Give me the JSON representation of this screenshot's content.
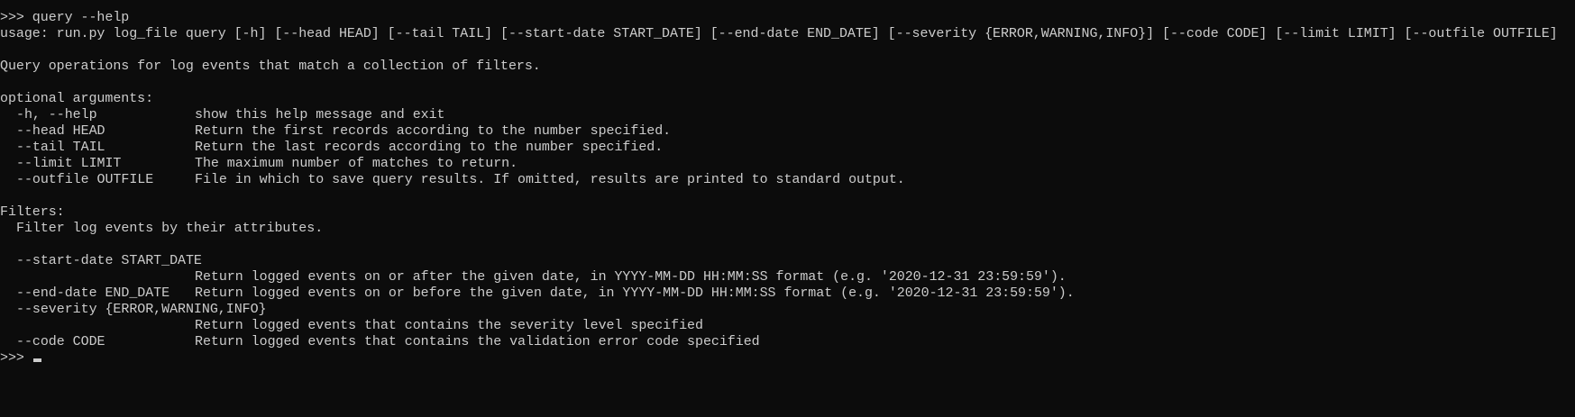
{
  "terminal": {
    "command_line": ">>> query --help",
    "usage": "usage: run.py log_file query [-h] [--head HEAD] [--tail TAIL] [--start-date START_DATE] [--end-date END_DATE] [--severity {ERROR,WARNING,INFO}] [--code CODE] [--limit LIMIT] [--outfile OUTFILE]",
    "description": "Query operations for log events that match a collection of filters.",
    "optional_header": "optional arguments:",
    "optional_args": [
      {
        "flag": "-h, --help",
        "desc": "show this help message and exit"
      },
      {
        "flag": "--head HEAD",
        "desc": "Return the first records according to the number specified."
      },
      {
        "flag": "--tail TAIL",
        "desc": "Return the last records according to the number specified."
      },
      {
        "flag": "--limit LIMIT",
        "desc": "The maximum number of matches to return."
      },
      {
        "flag": "--outfile OUTFILE",
        "desc": "File in which to save query results. If omitted, results are printed to standard output."
      }
    ],
    "filters_header": "Filters:",
    "filters_description": "Filter log events by their attributes.",
    "filter_args": {
      "start_date": {
        "flag": "--start-date START_DATE",
        "desc": "Return logged events on or after the given date, in YYYY-MM-DD HH:MM:SS format (e.g. '2020-12-31 23:59:59')."
      },
      "end_date": {
        "flag": "--end-date END_DATE",
        "desc": "Return logged events on or before the given date, in YYYY-MM-DD HH:MM:SS format (e.g. '2020-12-31 23:59:59')."
      },
      "severity": {
        "flag": "--severity {ERROR,WARNING,INFO}",
        "desc": "Return logged events that contains the severity level specified"
      },
      "code": {
        "flag": "--code CODE",
        "desc": "Return logged events that contains the validation error code specified"
      }
    },
    "prompt": ">>> "
  }
}
